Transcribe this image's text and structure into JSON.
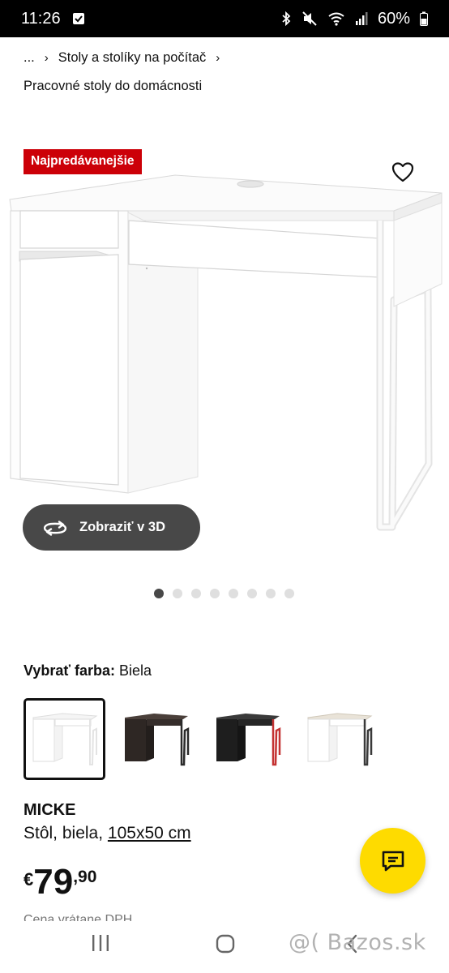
{
  "status_bar": {
    "time": "11:26",
    "battery": "60%",
    "icons": [
      "notification-check-icon",
      "bluetooth-icon",
      "mute-icon",
      "wifi-icon",
      "signal-icon",
      "battery-icon"
    ]
  },
  "breadcrumb": {
    "ellipsis": "...",
    "items": [
      "Stoly a stolíky na počítač"
    ],
    "sub": "Pracovné stoly do domácnosti"
  },
  "product": {
    "badge": "Najpredávanejšie",
    "view_3d_label": "Zobraziť v 3D",
    "color_label": "Vybrať farba:",
    "color_value": "Biela",
    "name": "MICKE",
    "desc_prefix": "Stôl, biela, ",
    "size": "105x50 cm",
    "price": {
      "currency": "€",
      "integer": "79",
      "decimal": ",90"
    },
    "footnote": "Cena vrátane DPH"
  },
  "carousel": {
    "total": 8,
    "active": 1
  },
  "swatches": [
    {
      "name": "white",
      "selected": true
    },
    {
      "name": "black-brown",
      "selected": false
    },
    {
      "name": "black-red",
      "selected": false
    },
    {
      "name": "white-anthracite",
      "selected": false
    }
  ],
  "watermark": "@( Bazos.sk",
  "colors": {
    "badge": "#cc0008",
    "button_dark": "#484848",
    "chat_fab": "#fedb00"
  }
}
